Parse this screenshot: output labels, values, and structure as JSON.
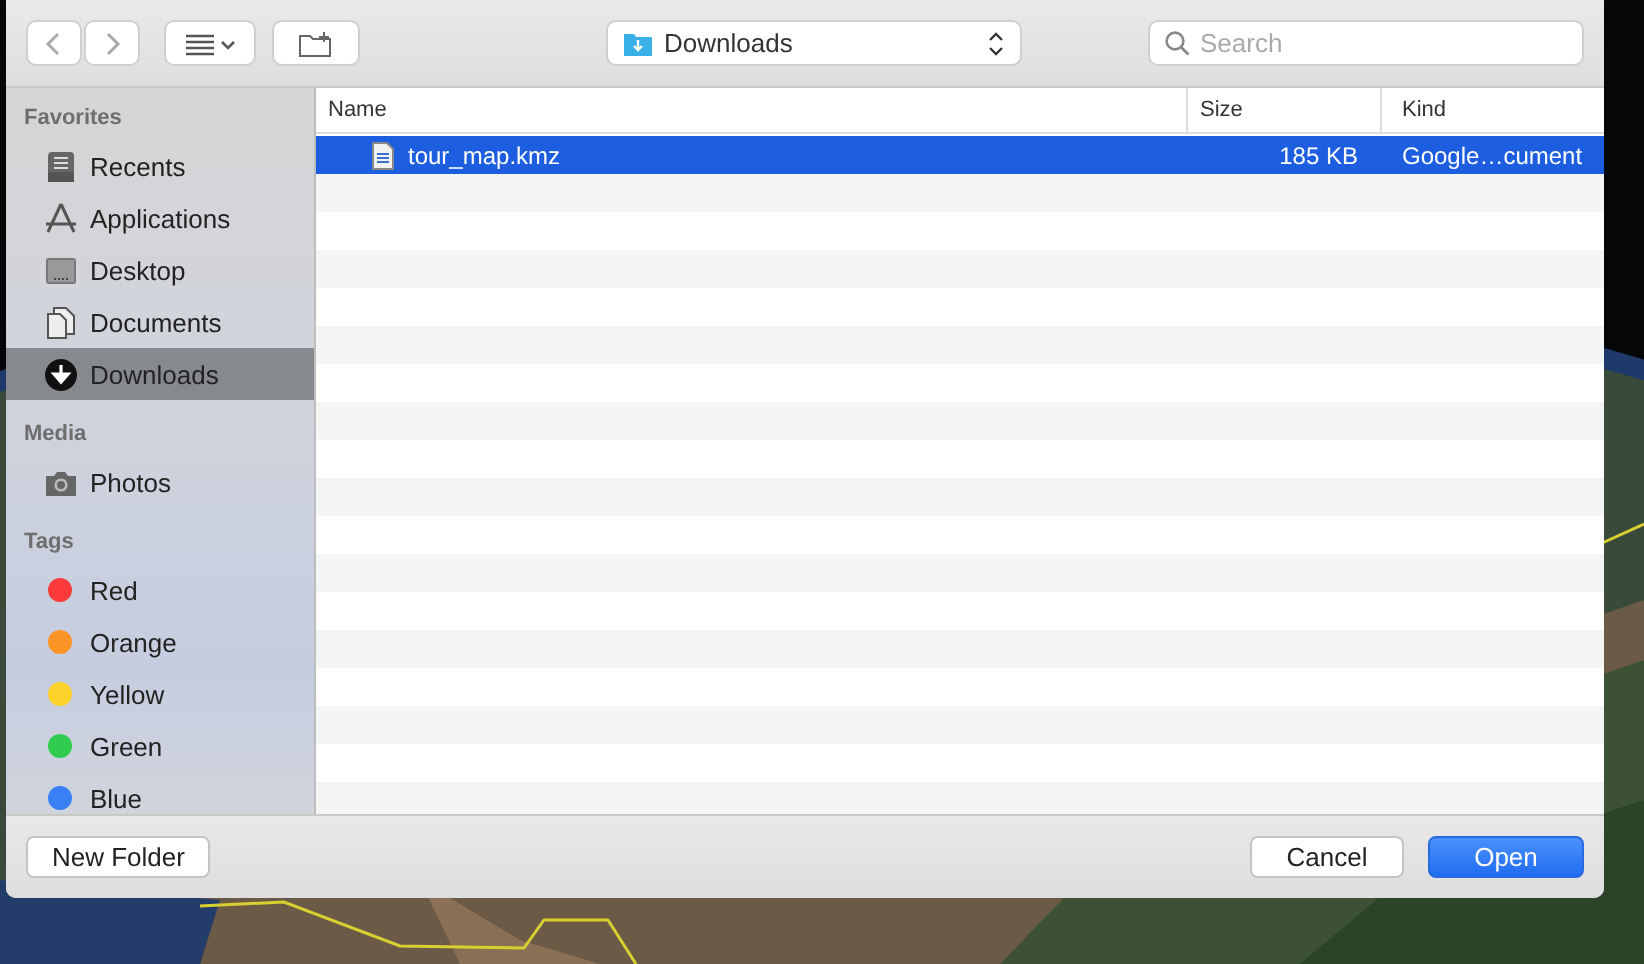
{
  "toolbar": {
    "location": "Downloads",
    "search": {
      "placeholder": "Search"
    }
  },
  "sidebar": {
    "favorites": {
      "title": "Favorites",
      "items": [
        {
          "label": "Recents",
          "selected": false
        },
        {
          "label": "Applications",
          "selected": false
        },
        {
          "label": "Desktop",
          "selected": false
        },
        {
          "label": "Documents",
          "selected": false
        },
        {
          "label": "Downloads",
          "selected": true
        }
      ]
    },
    "media": {
      "title": "Media",
      "items": [
        {
          "label": "Photos",
          "selected": false
        }
      ]
    },
    "tags": {
      "title": "Tags",
      "items": [
        {
          "label": "Red",
          "color": "#fc3a3a"
        },
        {
          "label": "Orange",
          "color": "#fd9526"
        },
        {
          "label": "Yellow",
          "color": "#fdd22b"
        },
        {
          "label": "Green",
          "color": "#2fcc4f"
        },
        {
          "label": "Blue",
          "color": "#3b7ff6"
        }
      ]
    }
  },
  "table": {
    "columns": [
      "Name",
      "Size",
      "Kind"
    ],
    "rows": [
      {
        "name": "tour_map.kmz",
        "size": "185 KB",
        "kind": "Google…cument",
        "selected": true
      }
    ]
  },
  "buttons": {
    "new_folder": "New Folder",
    "cancel": "Cancel",
    "open": "Open"
  }
}
